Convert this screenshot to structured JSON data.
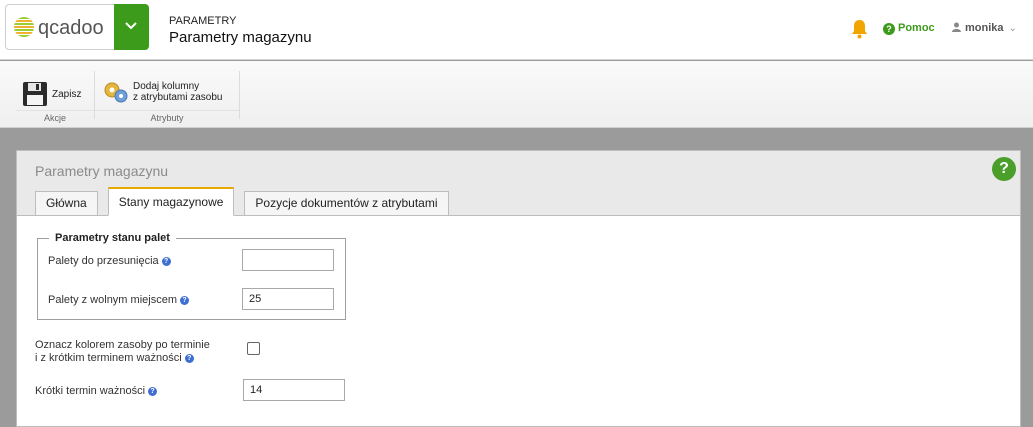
{
  "header": {
    "logo_text": "qcadoo",
    "breadcrumb_top": "PARAMETRY",
    "breadcrumb_title": "Parametry magazynu",
    "help_label": "Pomoc",
    "user_name": "monika",
    "accent_color": "#3d9b1b"
  },
  "ribbon": {
    "groups": [
      {
        "label": "Akcje",
        "buttons": [
          {
            "label": "Zapisz",
            "icon": "floppy-disk-icon"
          }
        ]
      },
      {
        "label": "Atrybuty",
        "buttons": [
          {
            "label_line1": "Dodaj kolumny",
            "label_line2": "z atrybutami zasobu",
            "icon": "gears-icon"
          }
        ]
      }
    ]
  },
  "panel": {
    "title": "Parametry magazynu",
    "tabs": [
      {
        "label": "Główna",
        "active": false
      },
      {
        "label": "Stany magazynowe",
        "active": true
      },
      {
        "label": "Pozycje dokumentów z atrybutami",
        "active": false
      }
    ],
    "pallet_section": {
      "legend": "Parametry stanu palet",
      "fields": [
        {
          "label": "Palety do przesunięcia",
          "value": ""
        },
        {
          "label": "Palety z wolnym miejscem",
          "value": "25"
        }
      ]
    },
    "color_expired": {
      "label_line1": "Oznacz kolorem zasoby po terminie",
      "label_line2": "i z krótkim terminem ważności",
      "checked": false
    },
    "short_expiry": {
      "label": "Krótki termin ważności",
      "value": "14"
    }
  }
}
